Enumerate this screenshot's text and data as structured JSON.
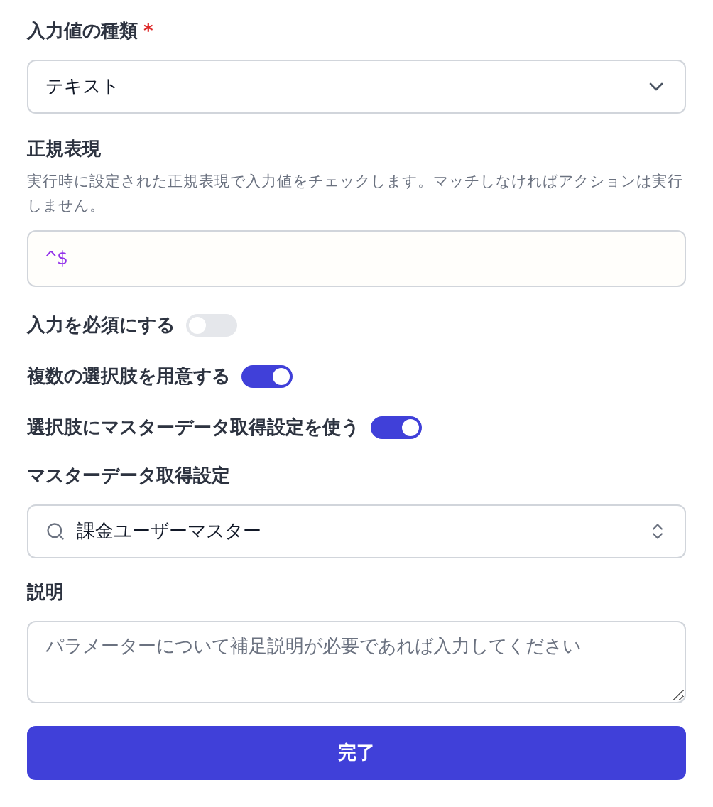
{
  "input_type": {
    "label": "入力値の種類",
    "required_mark": "*",
    "value": "テキスト"
  },
  "regex": {
    "label": "正規表現",
    "help": "実行時に設定された正規表現で入力値をチェックします。マッチしなければアクションは実行しません。",
    "value": "^$"
  },
  "toggles": [
    {
      "label": "入力を必須にする",
      "on": false
    },
    {
      "label": "複数の選択肢を用意する",
      "on": true
    },
    {
      "label": "選択肢にマスターデータ取得設定を使う",
      "on": true
    }
  ],
  "master_data": {
    "label": "マスターデータ取得設定",
    "value": "課金ユーザーマスター"
  },
  "description": {
    "label": "説明",
    "placeholder": "パラメーターについて補足説明が必要であれば入力してください"
  },
  "submit": {
    "label": "完了"
  }
}
